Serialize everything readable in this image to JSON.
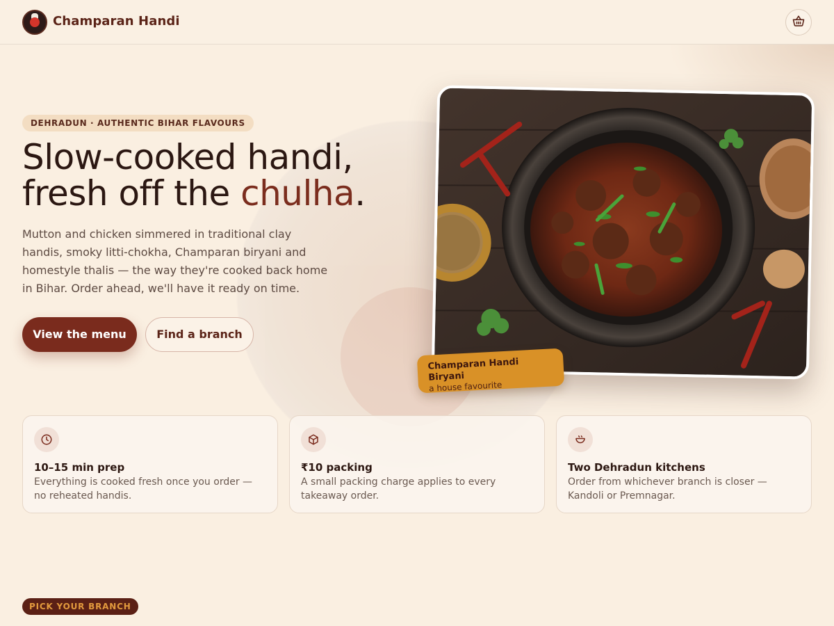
{
  "header": {
    "brand_name": "Champaran Handi",
    "logo_icon": "champaran-handi-logo",
    "cart_icon": "basket-icon"
  },
  "hero": {
    "eyebrow": "DEHRADUN · AUTHENTIC BIHAR FLAVOURS",
    "headline_line1": "Slow-cooked handi,",
    "headline_line2_prefix": "fresh off the ",
    "headline_line2_accent": "chulha",
    "headline_line2_suffix": ".",
    "lede": "Mutton and chicken simmered in traditional clay handis, smoky litti-chokha, Champaran biryani and homestyle thalis — the way they're cooked back home in Bihar. Order ahead, we'll have it ready on time.",
    "primary_cta": "View the menu",
    "secondary_cta": "Find a branch",
    "photo_caption_title": "Champaran Handi Biryani",
    "photo_caption_sub": "a house favourite"
  },
  "features": [
    {
      "icon": "clock-icon",
      "title": "10–15 min prep",
      "body": "Everything is cooked fresh once you order — no reheated handis."
    },
    {
      "icon": "package-icon",
      "title": "₹10 packing",
      "body": "A small packing charge applies to every takeaway order."
    },
    {
      "icon": "pot-icon",
      "title": "Two Dehradun kitchens",
      "body": "Order from whichever branch is closer — Kandoli or Premnagar."
    }
  ],
  "next_section": {
    "badge": "PICK YOUR BRANCH"
  },
  "colors": {
    "background": "#faefe1",
    "brand": "#7a2b1d",
    "accent_gold": "#d99127",
    "text_dark": "#2b1712"
  }
}
